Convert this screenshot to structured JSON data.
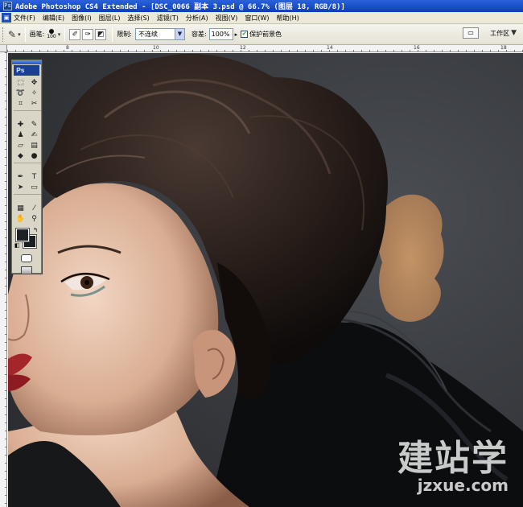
{
  "window": {
    "title": "Adobe Photoshop CS4 Extended - [DSC_0066 副本 3.psd @ 66.7% (图层 18, RGB/8)]",
    "app_logo": "Ps"
  },
  "menu": {
    "items": [
      "文件(F)",
      "编辑(E)",
      "图像(I)",
      "图层(L)",
      "选择(S)",
      "滤镜(T)",
      "分析(A)",
      "视图(V)",
      "窗口(W)",
      "帮助(H)"
    ]
  },
  "options": {
    "tool_icon": "background-eraser-icon",
    "brush_label": "画笔:",
    "brush_size": "100",
    "limits_label": "限制:",
    "limits_value": "不连续",
    "tolerance_label": "容差:",
    "tolerance_value": "100%",
    "protect_fg_label": "保护前景色",
    "protect_fg_checked": true,
    "workspace_label": "工作区"
  },
  "rulers": {
    "top_numbers": [
      "8",
      "10",
      "12",
      "14",
      "16",
      "18"
    ]
  },
  "toolbox": {
    "logo": "Ps",
    "foreground_color": "#1e2224",
    "background_color": "#1a1e1f"
  },
  "watermark": {
    "cn": "建站学",
    "url": "jzxue.com"
  }
}
